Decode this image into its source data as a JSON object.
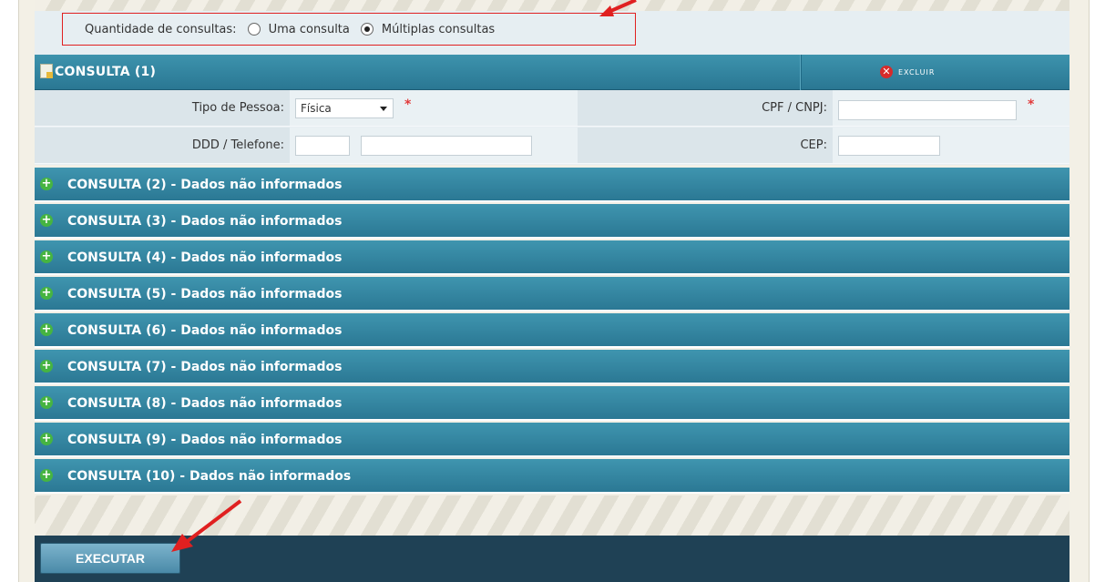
{
  "quantidade": {
    "label": "Quantidade de consultas:",
    "options": [
      {
        "label": "Uma consulta",
        "checked": false
      },
      {
        "label": "Múltiplas consultas",
        "checked": true
      }
    ]
  },
  "consulta1": {
    "title": "CONSULTA (1)",
    "delete_label": "EXCLUIR",
    "tipo_pessoa_label": "Tipo de Pessoa:",
    "tipo_pessoa_value": "Física",
    "cpf_cnpj_label": "CPF / CNPJ:",
    "ddd_telefone_label": "DDD / Telefone:",
    "cep_label": "CEP:",
    "required_mark": "*"
  },
  "accordions": [
    "CONSULTA (2) - Dados não informados",
    "CONSULTA (3) - Dados não informados",
    "CONSULTA (4) - Dados não informados",
    "CONSULTA (5) - Dados não informados",
    "CONSULTA (6) - Dados não informados",
    "CONSULTA (7) - Dados não informados",
    "CONSULTA (8) - Dados não informados",
    "CONSULTA (9) - Dados não informados",
    "CONSULTA (10) - Dados não informados"
  ],
  "footer": {
    "execute_label": "EXECUTAR"
  },
  "colors": {
    "accent": "#2b7894",
    "highlight": "#e02020",
    "add": "#46b441",
    "delete": "#d62b2b"
  }
}
